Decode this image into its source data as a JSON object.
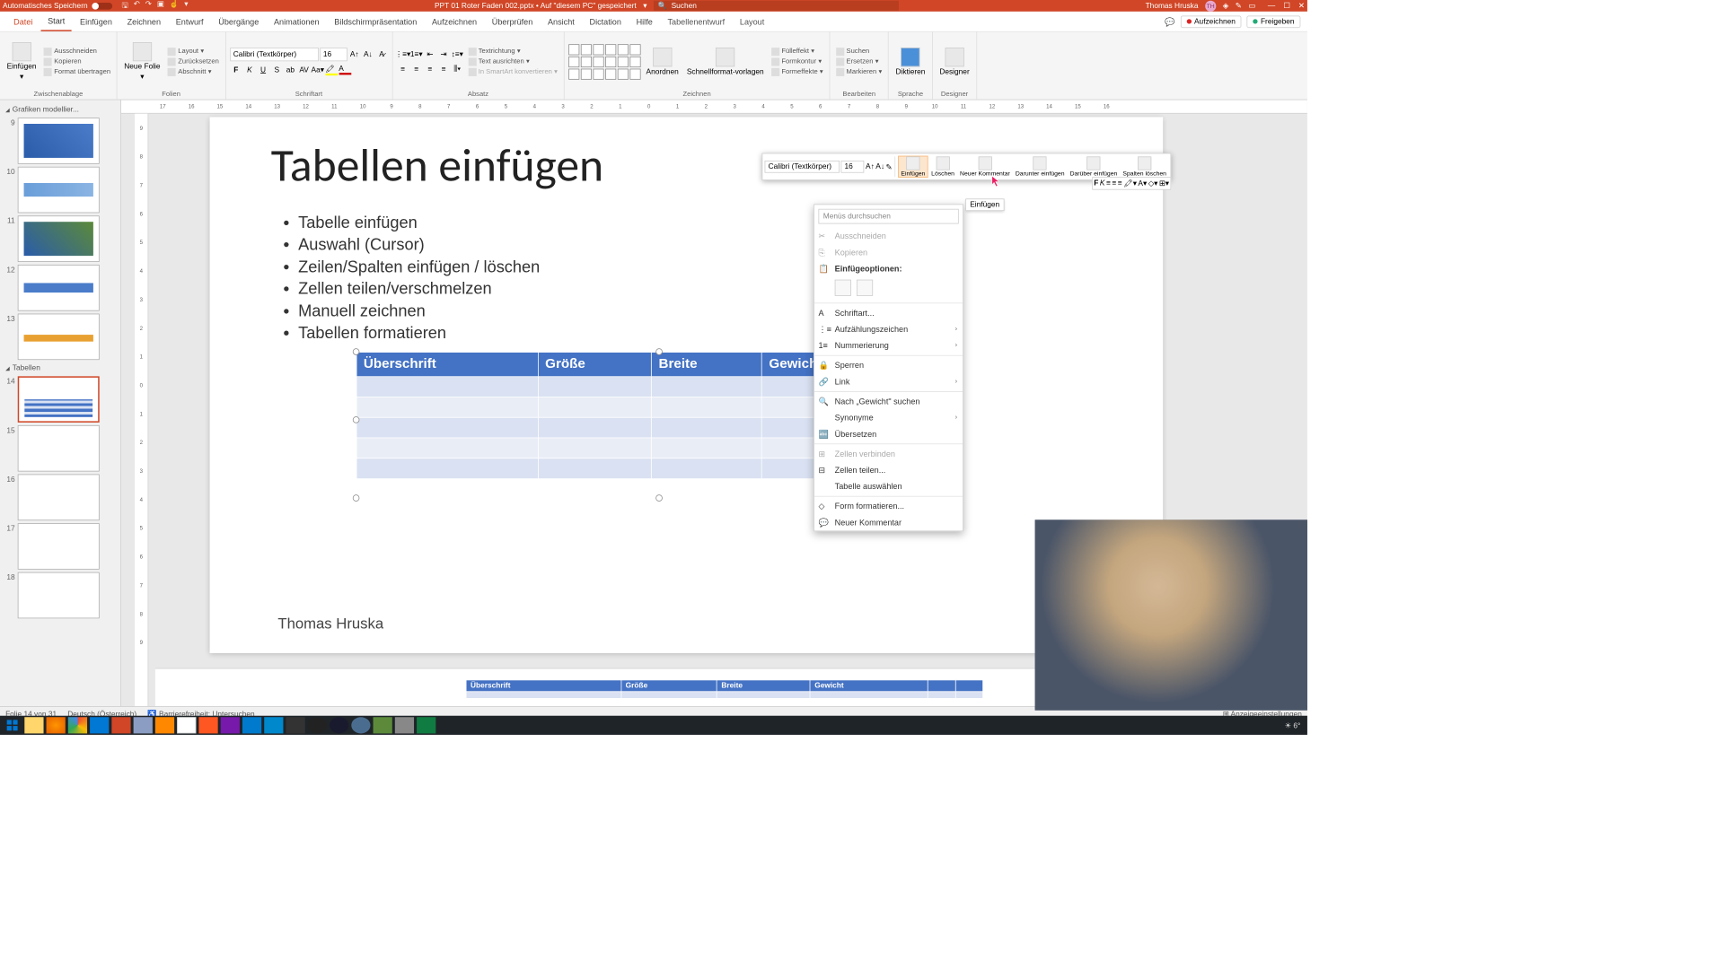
{
  "titlebar": {
    "autosave": "Automatisches Speichern",
    "filename": "PPT 01 Roter Faden 002.pptx • Auf \"diesem PC\" gespeichert",
    "search_placeholder": "Suchen",
    "user": "Thomas Hruska",
    "initials": "TH"
  },
  "tabs": {
    "file": "Datei",
    "home": "Start",
    "insert": "Einfügen",
    "draw": "Zeichnen",
    "design": "Entwurf",
    "transitions": "Übergänge",
    "animations": "Animationen",
    "slideshow": "Bildschirmpräsentation",
    "record": "Aufzeichnen",
    "review": "Überprüfen",
    "view": "Ansicht",
    "dictation": "Dictation",
    "help": "Hilfe",
    "tabledesign": "Tabellenentwurf",
    "layout": "Layout",
    "record_btn": "Aufzeichnen",
    "share_btn": "Freigeben"
  },
  "ribbon": {
    "clipboard": {
      "label": "Zwischenablage",
      "paste": "Einfügen",
      "cut": "Ausschneiden",
      "copy": "Kopieren",
      "formatpainter": "Format übertragen"
    },
    "slides": {
      "label": "Folien",
      "new": "Neue Folie",
      "layout": "Layout",
      "reset": "Zurücksetzen",
      "section": "Abschnitt"
    },
    "font": {
      "label": "Schriftart",
      "name": "Calibri (Textkörper)",
      "size": "16"
    },
    "paragraph": {
      "label": "Absatz",
      "textdir": "Textrichtung",
      "align": "Text ausrichten",
      "smartart": "In SmartArt konvertieren"
    },
    "drawing": {
      "label": "Zeichnen",
      "arrange": "Anordnen",
      "quickstyles": "Schnellformat-vorlagen",
      "fill": "Fülleffekt",
      "outline": "Formkontur",
      "effects": "Formeffekte"
    },
    "editing": {
      "label": "Bearbeiten",
      "find": "Suchen",
      "replace": "Ersetzen",
      "select": "Markieren"
    },
    "voice": {
      "label": "Sprache",
      "dictate": "Diktieren"
    },
    "designer": {
      "label": "Designer",
      "btn": "Designer"
    }
  },
  "thumbs": {
    "section1": "Grafiken modellier...",
    "section2": "Tabellen",
    "nums": [
      "9",
      "10",
      "11",
      "12",
      "13",
      "14",
      "15",
      "16",
      "17",
      "18"
    ]
  },
  "slide": {
    "title": "Tabellen einfügen",
    "bullets": [
      "Tabelle einfügen",
      "Auswahl (Cursor)",
      "Zeilen/Spalten einfügen / löschen",
      "Zellen teilen/verschmelzen",
      "Manuell zeichnen",
      "Tabellen formatieren"
    ],
    "headers": [
      "Überschrift",
      "Größe",
      "Breite",
      "Gewicht"
    ],
    "footer": "Thomas Hruska"
  },
  "minitb": {
    "font": "Calibri (Textkörper)",
    "size": "16",
    "insert": "Einfügen",
    "delete": "Löschen",
    "newcomment": "Neuer Kommentar",
    "below": "Darunter einfügen",
    "above": "Darüber einfügen",
    "delcols": "Spalten löschen",
    "tooltip": "Einfügen"
  },
  "ctx": {
    "search": "Menüs durchsuchen",
    "cut": "Ausschneiden",
    "copy": "Kopieren",
    "pasteopts": "Einfügeoptionen:",
    "font": "Schriftart...",
    "bullets": "Aufzählungszeichen",
    "numbering": "Nummerierung",
    "lock": "Sperren",
    "link": "Link",
    "searchfor": "Nach „Gewicht\" suchen",
    "synonyms": "Synonyme",
    "translate": "Übersetzen",
    "merge": "Zellen verbinden",
    "split": "Zellen teilen...",
    "selecttable": "Tabelle auswählen",
    "formatshape": "Form formatieren...",
    "newcomment": "Neuer Kommentar"
  },
  "status": {
    "slide": "Folie 14 von 31",
    "lang": "Deutsch (Österreich)",
    "access": "Barrierefreiheit: Untersuchen",
    "display": "Anzeigeeinstellungen"
  },
  "taskbar": {
    "temp": "6°"
  }
}
